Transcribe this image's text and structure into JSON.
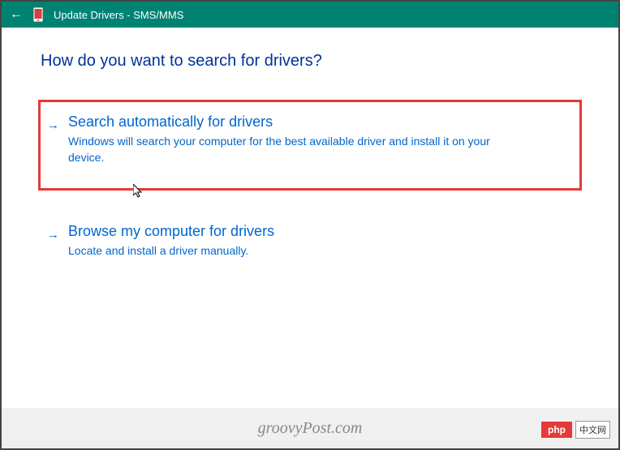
{
  "titlebar": {
    "back_icon": "←",
    "title": "Update Drivers - SMS/MMS"
  },
  "heading": "How do you want to search for drivers?",
  "options": [
    {
      "arrow": "→",
      "title": "Search automatically for drivers",
      "description": "Windows will search your computer for the best available driver and install it on your device."
    },
    {
      "arrow": "→",
      "title": "Browse my computer for drivers",
      "description": "Locate and install a driver manually."
    }
  ],
  "footer": {
    "watermark": "groovyPost.com",
    "badge_text": "php",
    "badge_cn": "中文网"
  }
}
